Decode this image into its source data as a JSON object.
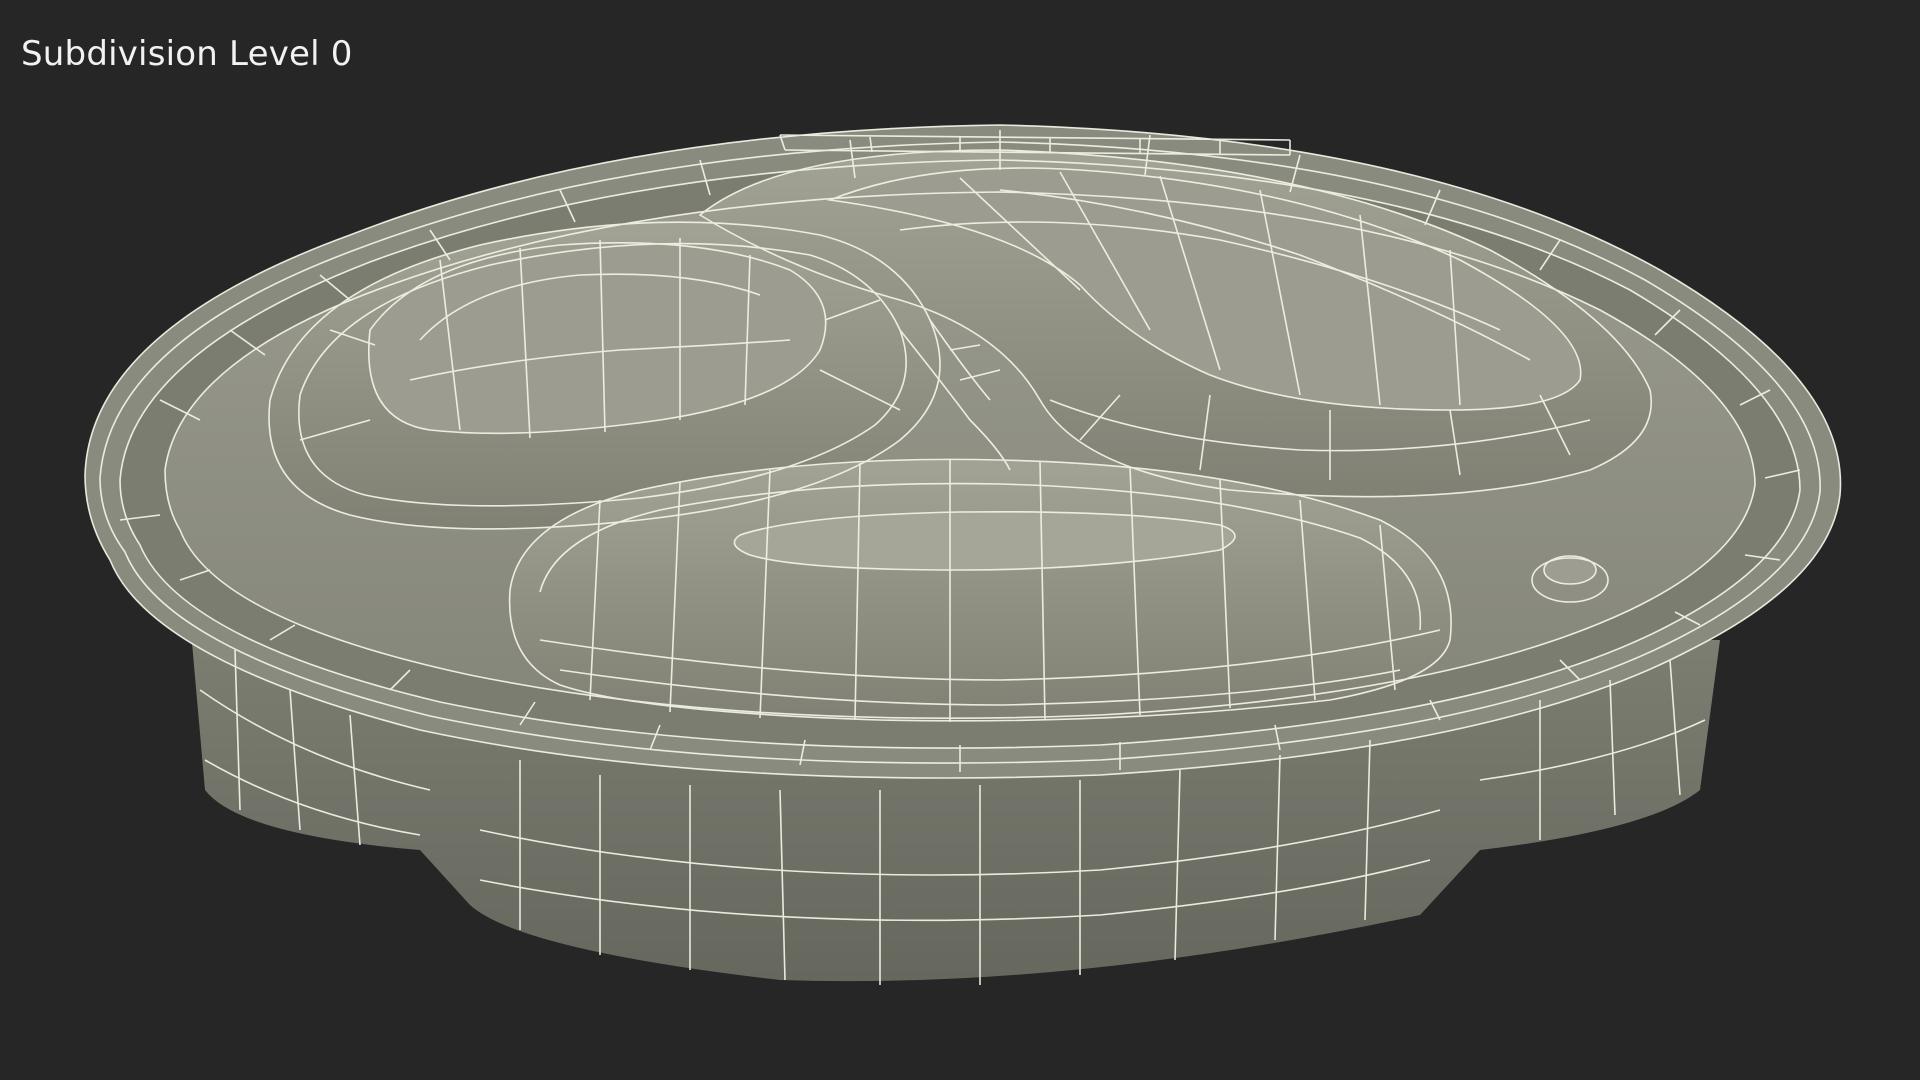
{
  "viewport": {
    "label": "Subdivision Level 0",
    "background_color": "#262626"
  },
  "model": {
    "subject": "round three-compartment food container lid",
    "view_mode": "wireframe-over-shaded",
    "surface_color": "#8e8f82",
    "shadow_color": "#6b6c61",
    "wire_color": "#f1f1e6"
  }
}
